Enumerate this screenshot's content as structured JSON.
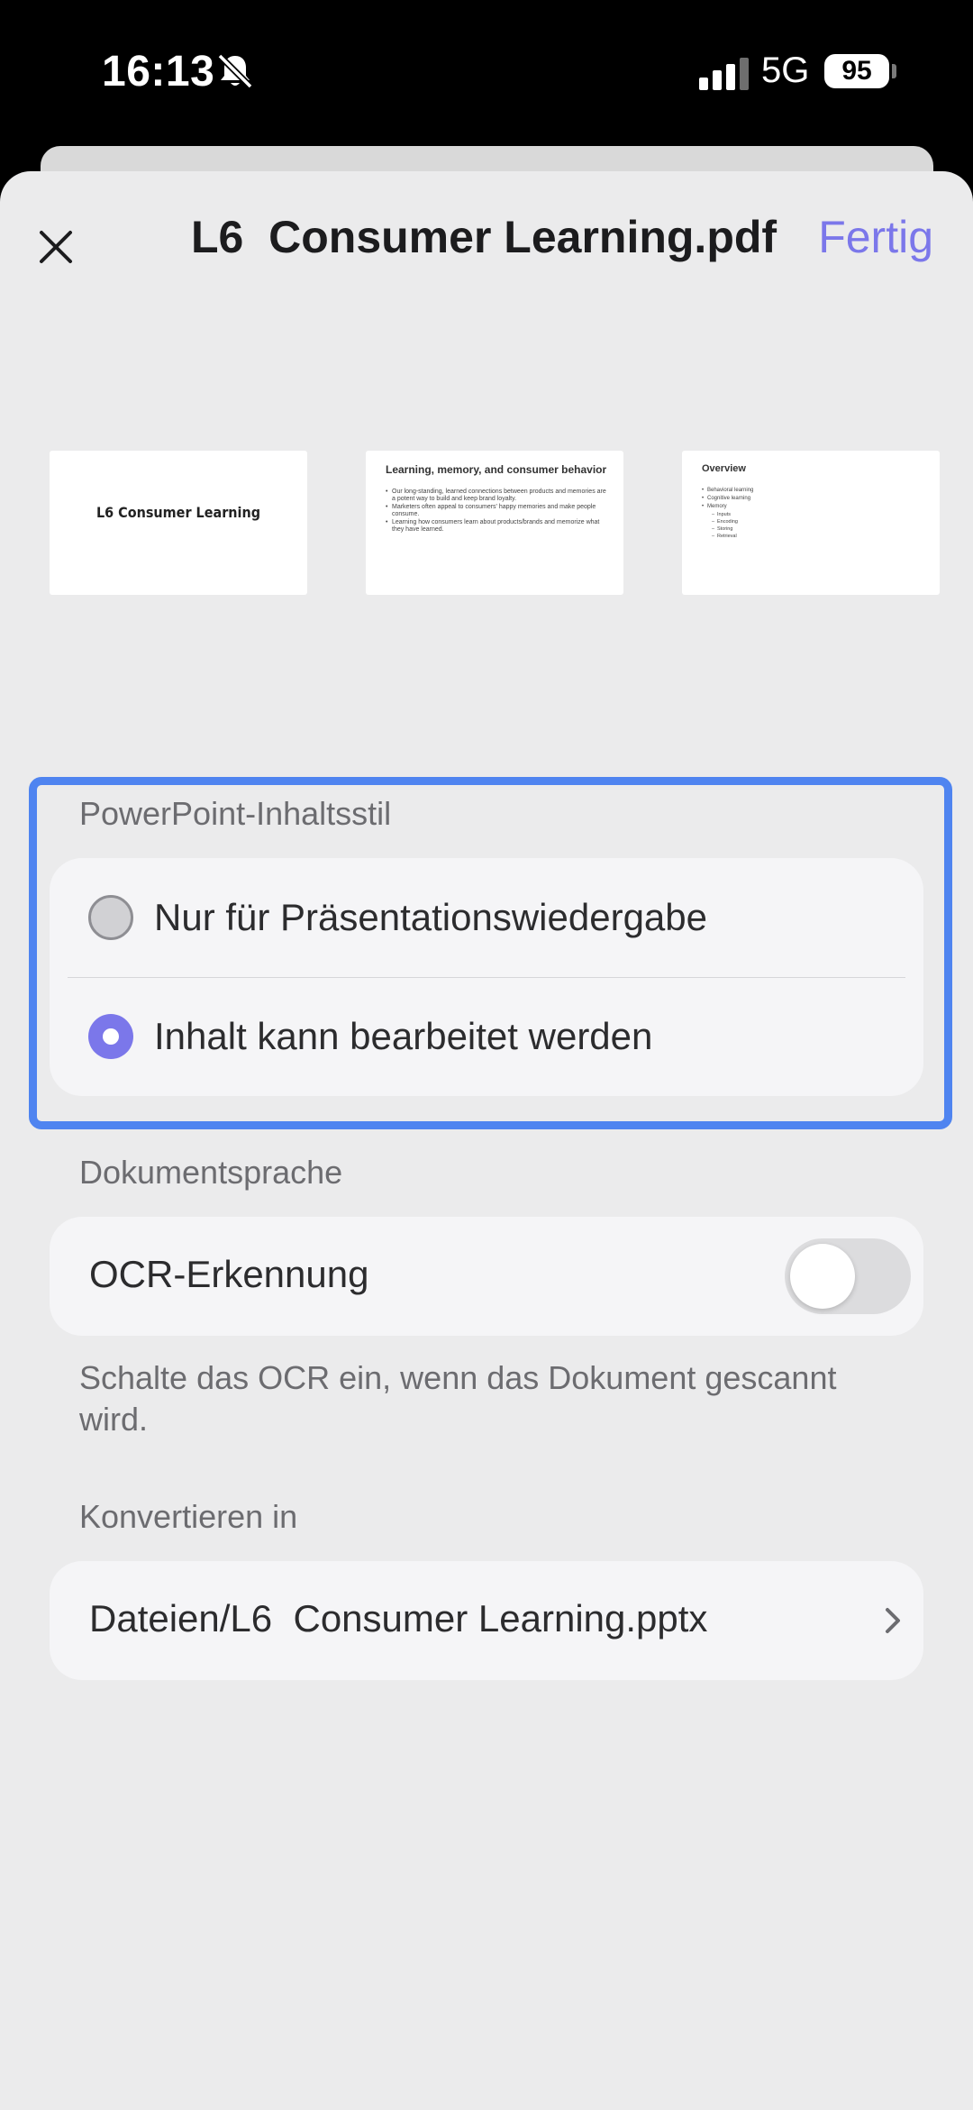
{
  "status_bar": {
    "time": "16:13",
    "network": "5G",
    "battery": "95",
    "icons": [
      "bell-slash-icon",
      "signal-icon"
    ]
  },
  "header": {
    "title": "L6  Consumer Learning.pdf",
    "done_label": "Fertig",
    "close_icon": "close-icon",
    "accent_color": "#7b77ea"
  },
  "thumbnails": [
    {
      "page": "1",
      "title": "L6 Consumer Learning"
    },
    {
      "page": "2",
      "title": "Learning, memory, and consumer behavior",
      "bullets": [
        "Our long-standing, learned connections between products and memories are a potent way to build and keep brand loyalty.",
        "Marketers often appeal to consumers' happy memories and make people consume.",
        "Learning how consumers learn about products/brands and memorize what they have learned."
      ]
    },
    {
      "page": "3",
      "title": "Overview",
      "bullets": [
        "Behavioral learning",
        "Cognitive learning",
        "Memory"
      ],
      "sub_bullets": [
        "Inputs",
        "Encoding",
        "Storing",
        "Retrieval"
      ]
    }
  ],
  "content_style": {
    "label": "PowerPoint-Inhaltsstil",
    "options": [
      {
        "label": "Nur für Präsentationswiedergabe",
        "selected": false
      },
      {
        "label": "Inhalt kann bearbeitet werden",
        "selected": true
      }
    ],
    "highlight_color": "#4f84f0"
  },
  "language": {
    "label": "Dokumentsprache",
    "ocr_label": "OCR-Erkennung",
    "ocr_enabled": false,
    "hint": "Schalte das OCR ein, wenn das Dokument gescannt wird."
  },
  "convert": {
    "label": "Konvertieren in",
    "destination": "Dateien/L6  Consumer Learning.pptx"
  }
}
